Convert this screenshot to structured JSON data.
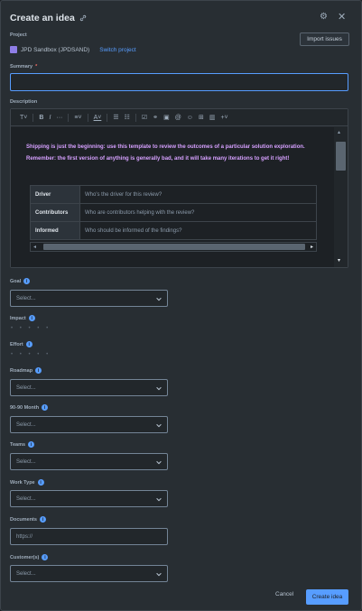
{
  "header": {
    "title": "Create an idea"
  },
  "import_button": "Import issues",
  "project": {
    "label": "Project",
    "name": "JPD Sandbox (JPDSAND)",
    "switch_link": "Switch project"
  },
  "summary": {
    "label": "Summary",
    "required_mark": "*",
    "value": ""
  },
  "description": {
    "label": "Description",
    "text": "Shipping is just the beginning: use this template to review the outcomes of a particular solution exploration. Remember: the first version of anything is generally bad, and it will take many iterations to get it right!",
    "rows": [
      {
        "header": "Driver",
        "value": "Who's the driver for this review?"
      },
      {
        "header": "Contributors",
        "value": "Who are contributors helping with the review?"
      },
      {
        "header": "Informed",
        "value": "Who should be informed of the findings?"
      }
    ]
  },
  "fields": {
    "goal": {
      "label": "Goal",
      "placeholder": "Select..."
    },
    "impact": {
      "label": "Impact",
      "rating": "• • • • •"
    },
    "effort": {
      "label": "Effort",
      "rating": "• • • • •"
    },
    "roadmap": {
      "label": "Roadmap",
      "placeholder": "Select..."
    },
    "month": {
      "label": "90-90 Month",
      "placeholder": "Select..."
    },
    "teams": {
      "label": "Teams",
      "placeholder": "Select..."
    },
    "work_type": {
      "label": "Work Type",
      "placeholder": "Select..."
    },
    "documents": {
      "label": "Documents",
      "placeholder": "https://"
    },
    "customers": {
      "label": "Customer(s)",
      "placeholder": "Select..."
    }
  },
  "footer": {
    "cancel": "Cancel",
    "create": "Create idea"
  },
  "colors": {
    "accent": "#579dff",
    "background": "#282e33",
    "description_text": "#d6a0ff"
  }
}
